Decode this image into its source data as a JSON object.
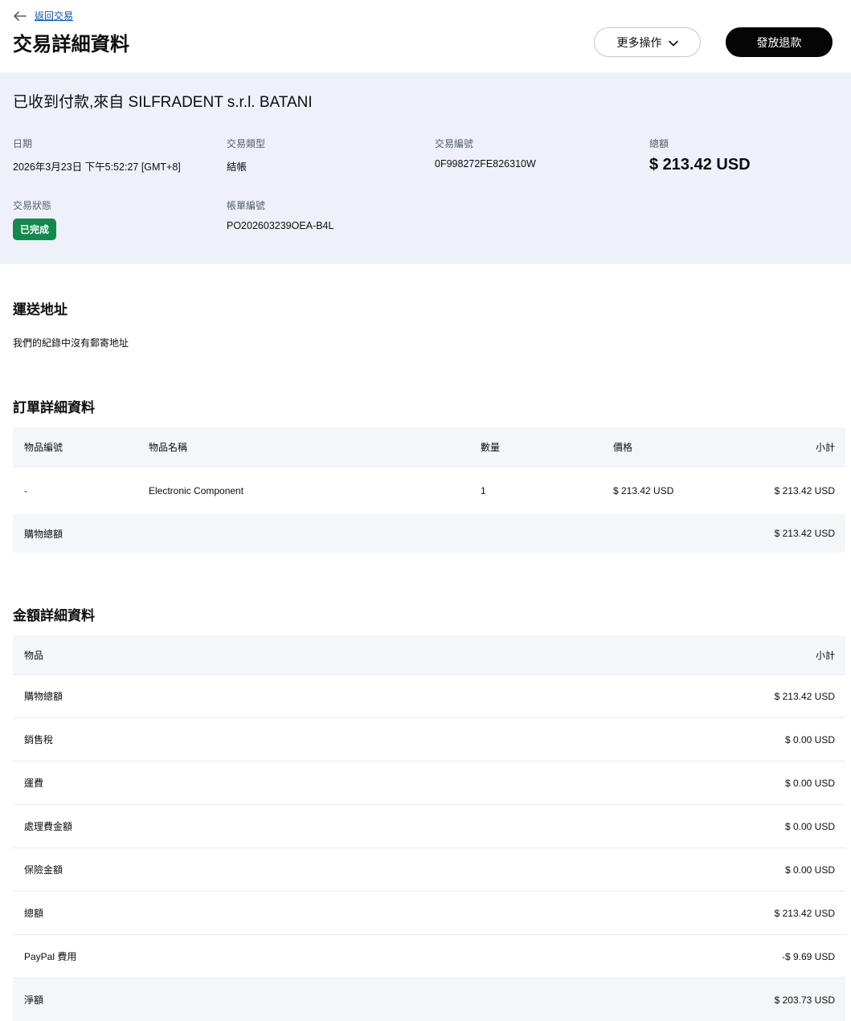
{
  "page": {
    "back_link": "返回交易",
    "title": "交易詳細資料"
  },
  "actions": {
    "more_label": "更多操作",
    "refund_label": "發放退款"
  },
  "summary": {
    "heading": "已收到付款,來自 SILFRADENT s.r.l. BATANI",
    "fields": {
      "date": {
        "label": "日期",
        "value": "2026年3月23日 下午5:52:27 [GMT+8]"
      },
      "type": {
        "label": "交易類型",
        "value": "結帳"
      },
      "txn_id": {
        "label": "交易編號",
        "value": "0F998272FE826310W"
      },
      "total": {
        "label": "總額",
        "value": "$ 213.42 USD"
      },
      "status": {
        "label": "交易狀態",
        "badge": "已完成"
      },
      "invoice": {
        "label": "帳單編號",
        "value": "PO202603239OEA-B4L"
      }
    }
  },
  "shipping": {
    "heading": "運送地址",
    "empty_text": "我們的紀錄中沒有郵寄地址"
  },
  "order": {
    "heading": "訂單詳細資料",
    "headers": {
      "item_id": "物品編號",
      "item_name": "物品名稱",
      "qty": "數量",
      "price": "價格",
      "subtotal": "小計"
    },
    "rows": [
      {
        "item_id": "-",
        "item_name": "Electronic Component",
        "qty": "1",
        "price": "$ 213.42 USD",
        "subtotal": "$ 213.42 USD"
      }
    ],
    "footer": {
      "label": "購物總額",
      "value": "$ 213.42 USD"
    }
  },
  "amounts": {
    "heading": "金額詳細資料",
    "headers": {
      "item": "物品",
      "subtotal": "小計"
    },
    "rows": [
      {
        "label": "購物總額",
        "value": "$ 213.42 USD"
      },
      {
        "label": "銷售稅",
        "value": "$ 0.00 USD"
      },
      {
        "label": "運費",
        "value": "$ 0.00 USD"
      },
      {
        "label": "處理費金額",
        "value": "$ 0.00 USD"
      },
      {
        "label": "保險金額",
        "value": "$ 0.00 USD"
      },
      {
        "label": "總額",
        "value": "$ 213.42 USD"
      },
      {
        "label": "PayPal 費用",
        "value": "-$ 9.69 USD"
      },
      {
        "label": "淨額",
        "value": "$ 203.73 USD"
      }
    ]
  },
  "colors": {
    "status_green": "#128a4d",
    "link_blue": "#0551b5",
    "summary_bg": "#eef1f9",
    "table_header_bg": "#f5f6fa",
    "refund_button_bg": "#050505"
  }
}
